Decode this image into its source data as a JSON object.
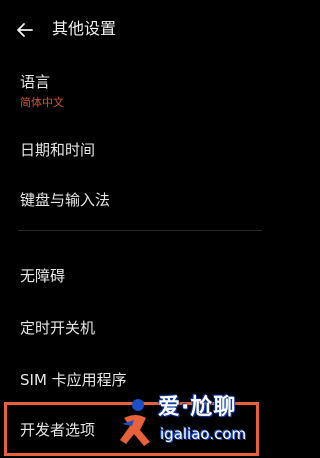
{
  "header": {
    "title": "其他设置",
    "back_icon": "arrow-left-icon"
  },
  "menu": {
    "items": [
      {
        "label": "语言",
        "sublabel": "简体中文"
      },
      {
        "label": "日期和时间"
      },
      {
        "label": "键盘与输入法"
      },
      {
        "label": "无障碍"
      },
      {
        "label": "定时开关机"
      },
      {
        "label": "SIM 卡应用程序"
      },
      {
        "label": "开发者选项"
      }
    ]
  },
  "watermark": {
    "title": "爱·尬聊",
    "url": "igaliao.com"
  },
  "colors": {
    "background": "#000000",
    "text": "#e6e6e6",
    "sublabel_accent": "#d0532e",
    "highlight_border": "#e8613a",
    "divider": "#2a2a2a"
  }
}
